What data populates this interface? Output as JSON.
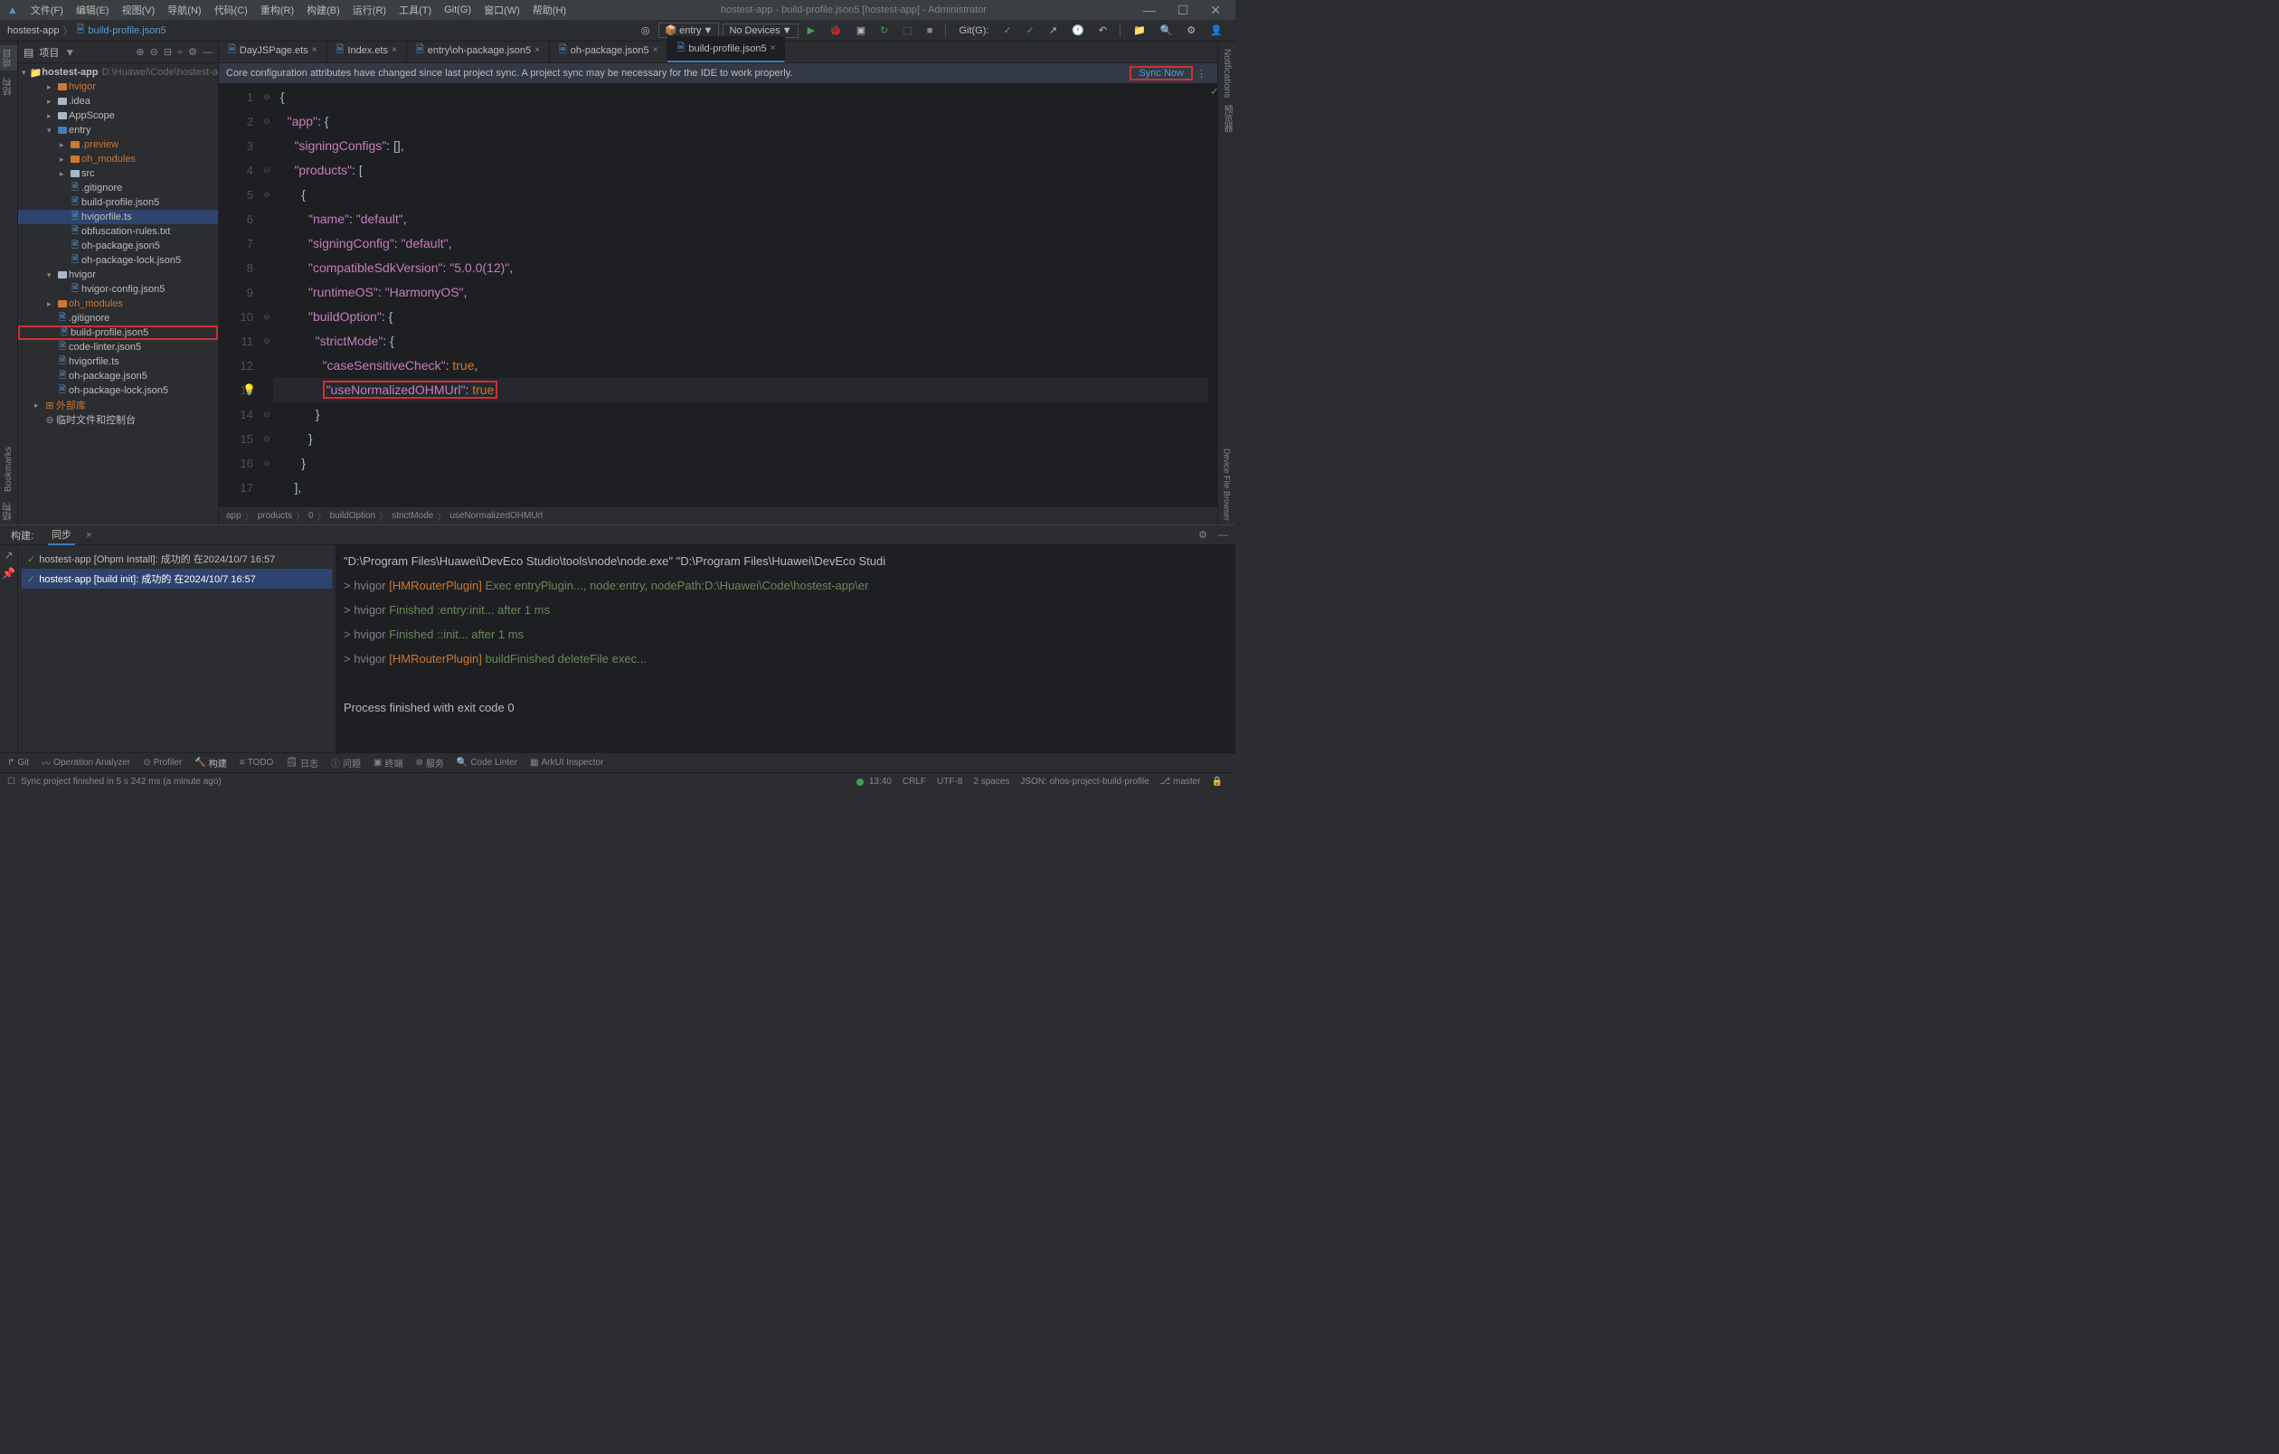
{
  "window": {
    "title": "hostest-app - build-profile.json5 [hostest-app] - Administrator"
  },
  "menu": {
    "items": [
      "文件(F)",
      "编辑(E)",
      "视图(V)",
      "导航(N)",
      "代码(C)",
      "重构(R)",
      "构建(B)",
      "运行(R)",
      "工具(T)",
      "Git(G)",
      "窗口(W)",
      "帮助(H)"
    ]
  },
  "nav": {
    "crumbs": [
      "hostest-app",
      "build-profile.json5"
    ],
    "module_sel": "entry",
    "device_sel": "No Devices",
    "git_label": "Git(G):"
  },
  "sidebar": {
    "header_label": "项目",
    "root": {
      "name": "hostest-app",
      "hint": "D:\\Huawei\\Code\\hostest-a"
    },
    "items": [
      {
        "name": "hvigor",
        "depth": 2,
        "arrow": ">",
        "folder": "orange"
      },
      {
        "name": ".idea",
        "depth": 2,
        "arrow": ">",
        "folder": "grey"
      },
      {
        "name": "AppScope",
        "depth": 2,
        "arrow": ">",
        "folder": "grey"
      },
      {
        "name": "entry",
        "depth": 2,
        "arrow": "v",
        "folder": "blue"
      },
      {
        "name": ".preview",
        "depth": 3,
        "arrow": ">",
        "folder": "orange"
      },
      {
        "name": "oh_modules",
        "depth": 3,
        "arrow": ">",
        "folder": "orange"
      },
      {
        "name": "src",
        "depth": 3,
        "arrow": ">",
        "folder": "grey"
      },
      {
        "name": ".gitignore",
        "depth": 3,
        "file": true
      },
      {
        "name": "build-profile.json5",
        "depth": 3,
        "file": true
      },
      {
        "name": "hvigorfile.ts",
        "depth": 3,
        "file": true,
        "selected": true
      },
      {
        "name": "obfuscation-rules.txt",
        "depth": 3,
        "file": true
      },
      {
        "name": "oh-package.json5",
        "depth": 3,
        "file": true
      },
      {
        "name": "oh-package-lock.json5",
        "depth": 3,
        "file": true
      },
      {
        "name": "hvigor",
        "depth": 2,
        "arrow": "v",
        "folder": "grey"
      },
      {
        "name": "hvigor-config.json5",
        "depth": 3,
        "file": true
      },
      {
        "name": "oh_modules",
        "depth": 2,
        "arrow": ">",
        "folder": "orange"
      },
      {
        "name": ".gitignore",
        "depth": 2,
        "file": true
      },
      {
        "name": "build-profile.json5",
        "depth": 2,
        "file": true,
        "highlight": true
      },
      {
        "name": "code-linter.json5",
        "depth": 2,
        "file": true
      },
      {
        "name": "hvigorfile.ts",
        "depth": 2,
        "file": true
      },
      {
        "name": "oh-package.json5",
        "depth": 2,
        "file": true
      },
      {
        "name": "oh-package-lock.json5",
        "depth": 2,
        "file": true
      },
      {
        "name": "外部库",
        "depth": 1,
        "arrow": ">",
        "lib": true
      },
      {
        "name": "临时文件和控制台",
        "depth": 1,
        "scratch": true
      }
    ]
  },
  "tabs": [
    {
      "label": "DayJSPage.ets"
    },
    {
      "label": "Index.ets"
    },
    {
      "label": "entry\\oh-package.json5"
    },
    {
      "label": "oh-package.json5"
    },
    {
      "label": "build-profile.json5",
      "active": true
    }
  ],
  "sync": {
    "msg": "Core configuration attributes have changed since last project sync. A project sync may be necessary for the IDE to work properly.",
    "btn": "Sync Now"
  },
  "code": {
    "lines": [
      1,
      2,
      3,
      4,
      5,
      6,
      7,
      8,
      9,
      10,
      11,
      12,
      13,
      14,
      15,
      16,
      17
    ],
    "l1": "{",
    "l2_key": "\"app\"",
    "l2_rest": ": {",
    "l3_key": "\"signingConfigs\"",
    "l3_rest": ": [],",
    "l4_key": "\"products\"",
    "l4_rest": ": [",
    "l5": "{",
    "l6_key": "\"name\"",
    "l6_val": "\"default\"",
    "l7_key": "\"signingConfig\"",
    "l7_val": "\"default\"",
    "l8_key": "\"compatibleSdkVersion\"",
    "l8_val": "\"5.0.0(12)\"",
    "l9_key": "\"runtimeOS\"",
    "l9_val": "\"HarmonyOS\"",
    "l10_key": "\"buildOption\"",
    "l10_rest": ": {",
    "l11_key": "\"strictMode\"",
    "l11_rest": ": {",
    "l12_key": "\"caseSensitiveCheck\"",
    "l12_val": "true",
    "l13_key": "\"useNormalizedOHMUrl\"",
    "l13_val": "true",
    "l14": "}",
    "l15": "}",
    "l16": "}",
    "l17": "],"
  },
  "crumb_path": [
    "app",
    "products",
    "0",
    "buildOption",
    "strictMode",
    "useNormalizedOHMUrl"
  ],
  "bottom": {
    "tabs": [
      "构建:",
      "同步"
    ],
    "tasks": [
      {
        "label": "hostest-app [Ohpm Install]: 成功的 在2024/10/7 16:57"
      },
      {
        "label": "hostest-app [build init]: 成功的 在2024/10/7 16:57",
        "selected": true
      }
    ],
    "console_cmd": "\"D:\\Program Files\\Huawei\\DevEco Studio\\tools\\node\\node.exe\" \"D:\\Program Files\\Huawei\\DevEco Studi",
    "console_l2a": "> hvigor ",
    "console_l2b": "[HMRouterPlugin]",
    "console_l2c": " Exec entryPlugin..., node:entry, nodePath:D:\\Huawei\\Code\\hostest-app\\er",
    "console_l3a": "> hvigor ",
    "console_l3b": "Finished",
    "console_l3c": " :entry:init... after 1 ms",
    "console_l4a": "> hvigor ",
    "console_l4b": "Finished",
    "console_l4c": " ::init... after 1 ms",
    "console_l5a": "> hvigor ",
    "console_l5b": "[HMRouterPlugin]",
    "console_l5c": " buildFinished deleteFile exec...",
    "console_done": "Process finished with exit code 0"
  },
  "toolwin": [
    "Git",
    "Operation Analyzer",
    "Profiler",
    "构建",
    "TODO",
    "日志",
    "问题",
    "终端",
    "服务",
    "Code Linter",
    "ArkUI Inspector"
  ],
  "status": {
    "msg": "Sync project finished in 5 s 242 ms (a minute ago)",
    "pos": "13:40",
    "eol": "CRLF",
    "enc": "UTF-8",
    "indent": "2 spaces",
    "lang": "JSON: ohos-project-build-profile",
    "branch": "master"
  },
  "left_stripe": [
    "项目",
    "结构"
  ],
  "right_stripe": [
    "Notifications",
    "预览器"
  ]
}
